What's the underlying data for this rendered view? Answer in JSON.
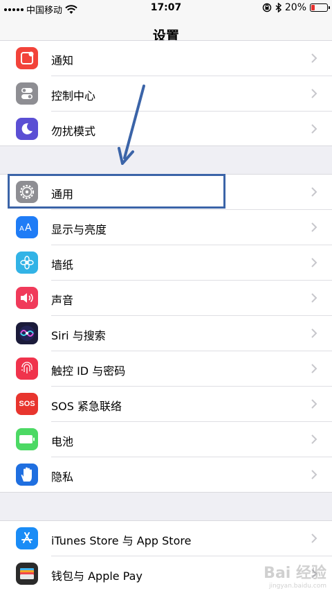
{
  "status_bar": {
    "carrier": "中国移动",
    "time": "17:07",
    "battery_percent": "20%",
    "battery_level": 0.2,
    "battery_color": "#e8302e"
  },
  "nav": {
    "title": "设置"
  },
  "groups": [
    {
      "items": [
        {
          "id": "notifications",
          "label": "通知",
          "icon": "notifications-icon",
          "color": "#f2433a"
        },
        {
          "id": "control-center",
          "label": "控制中心",
          "icon": "control-center-icon",
          "color": "#8e8e93"
        },
        {
          "id": "do-not-disturb",
          "label": "勿扰模式",
          "icon": "moon-icon",
          "color": "#5b4fd4"
        }
      ]
    },
    {
      "items": [
        {
          "id": "general",
          "label": "通用",
          "icon": "gear-icon",
          "color": "#8e8e93"
        },
        {
          "id": "display",
          "label": "显示与亮度",
          "icon": "display-brightness-icon",
          "color": "#1f7cf6"
        },
        {
          "id": "wallpaper",
          "label": "墙纸",
          "icon": "wallpaper-icon",
          "color": "#32b3e6"
        },
        {
          "id": "sounds",
          "label": "声音",
          "icon": "speaker-icon",
          "color": "#f03a5a"
        },
        {
          "id": "siri",
          "label": "Siri 与搜索",
          "icon": "siri-icon",
          "color": "#1b1b3a"
        },
        {
          "id": "touch-id",
          "label": "触控 ID 与密码",
          "icon": "fingerprint-icon",
          "color": "#f0334c"
        },
        {
          "id": "sos",
          "label": "SOS 紧急联络",
          "icon": "sos-icon",
          "color": "#e8352e",
          "icon_text": "SOS"
        },
        {
          "id": "battery",
          "label": "电池",
          "icon": "battery-icon",
          "color": "#4cd964"
        },
        {
          "id": "privacy",
          "label": "隐私",
          "icon": "hand-icon",
          "color": "#1f6fe0"
        }
      ]
    },
    {
      "items": [
        {
          "id": "app-store",
          "label": "iTunes Store 与 App Store",
          "icon": "app-store-icon",
          "color": "#1a8cf6"
        },
        {
          "id": "wallet",
          "label": "钱包与 Apple Pay",
          "icon": "wallet-icon",
          "color": "#2b2b2b"
        }
      ]
    }
  ],
  "highlight_color": "#3b64a8",
  "watermark": {
    "text": "Bai 经验",
    "sub": "jingyan.baidu.com"
  }
}
